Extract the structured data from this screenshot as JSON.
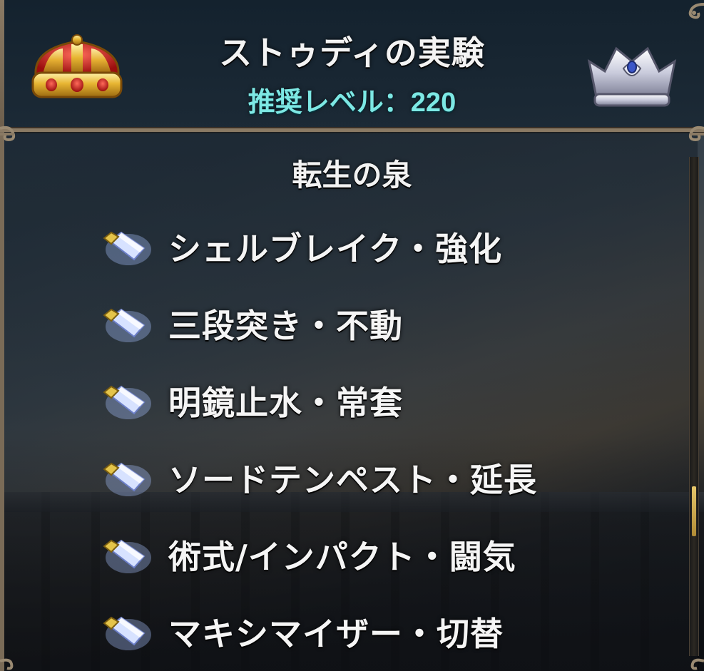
{
  "header": {
    "title": "ストゥディの実験",
    "level_label": "推奨レベル：",
    "level_value": "220",
    "left_crown_icon": "gold-crown-icon",
    "right_crown_icon": "silver-crown-icon"
  },
  "section": {
    "title": "転生の泉"
  },
  "skills": [
    {
      "label": "シェルブレイク・強化",
      "icon": "crystal-shard-icon"
    },
    {
      "label": "三段突き・不動",
      "icon": "crystal-shard-icon"
    },
    {
      "label": "明鏡止水・常套",
      "icon": "crystal-shard-icon"
    },
    {
      "label": "ソードテンペスト・延長",
      "icon": "crystal-shard-icon"
    },
    {
      "label": "術式/インパクト・闘気",
      "icon": "crystal-shard-icon"
    },
    {
      "label": "マキシマイザー・切替",
      "icon": "crystal-shard-icon"
    }
  ],
  "colors": {
    "title_text": "#f3f3f3",
    "level_text": "#7de8e4",
    "frame": "#8a7a64",
    "scroll_thumb": "#e6c66a"
  }
}
